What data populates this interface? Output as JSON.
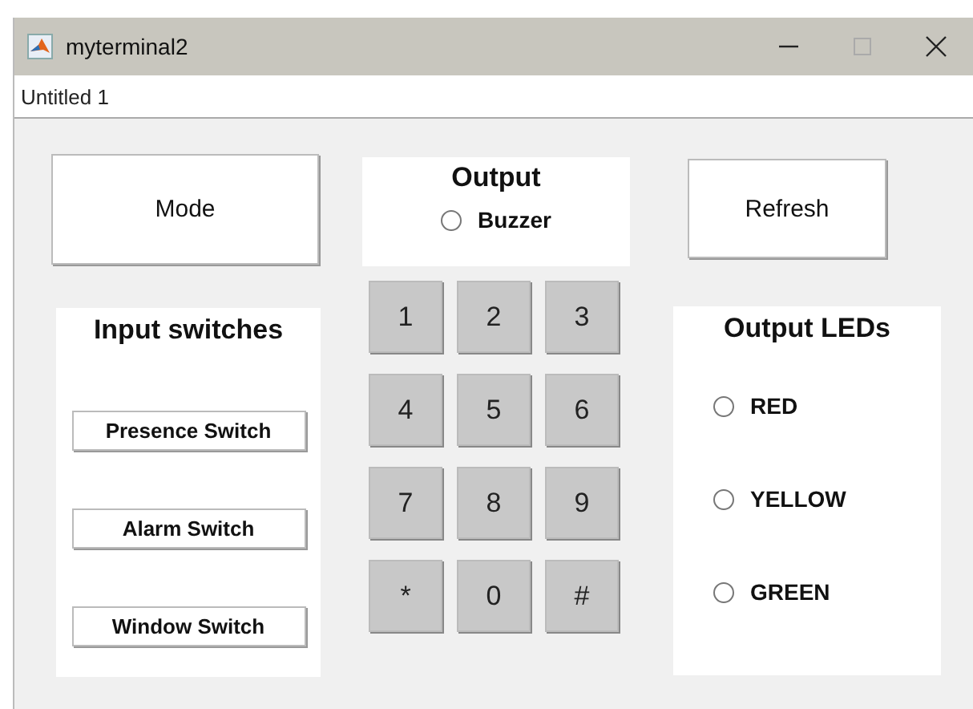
{
  "window": {
    "title": "myterminal2"
  },
  "document_tab": {
    "label": "Untitled 1"
  },
  "mode_button": {
    "label": "Mode"
  },
  "output_panel": {
    "title": "Output",
    "radios": [
      {
        "label": "Buzzer",
        "selected": false
      }
    ]
  },
  "refresh_button": {
    "label": "Refresh"
  },
  "input_panel": {
    "title": "Input switches",
    "buttons": [
      "Presence Switch",
      "Alarm Switch",
      "Window Switch"
    ]
  },
  "keypad": {
    "keys": [
      "1",
      "2",
      "3",
      "4",
      "5",
      "6",
      "7",
      "8",
      "9",
      "*",
      "0",
      "#"
    ]
  },
  "leds_panel": {
    "title": "Output LEDs",
    "radios": [
      {
        "label": "RED",
        "selected": false
      },
      {
        "label": "YELLOW",
        "selected": false
      },
      {
        "label": "GREEN",
        "selected": false
      }
    ]
  }
}
